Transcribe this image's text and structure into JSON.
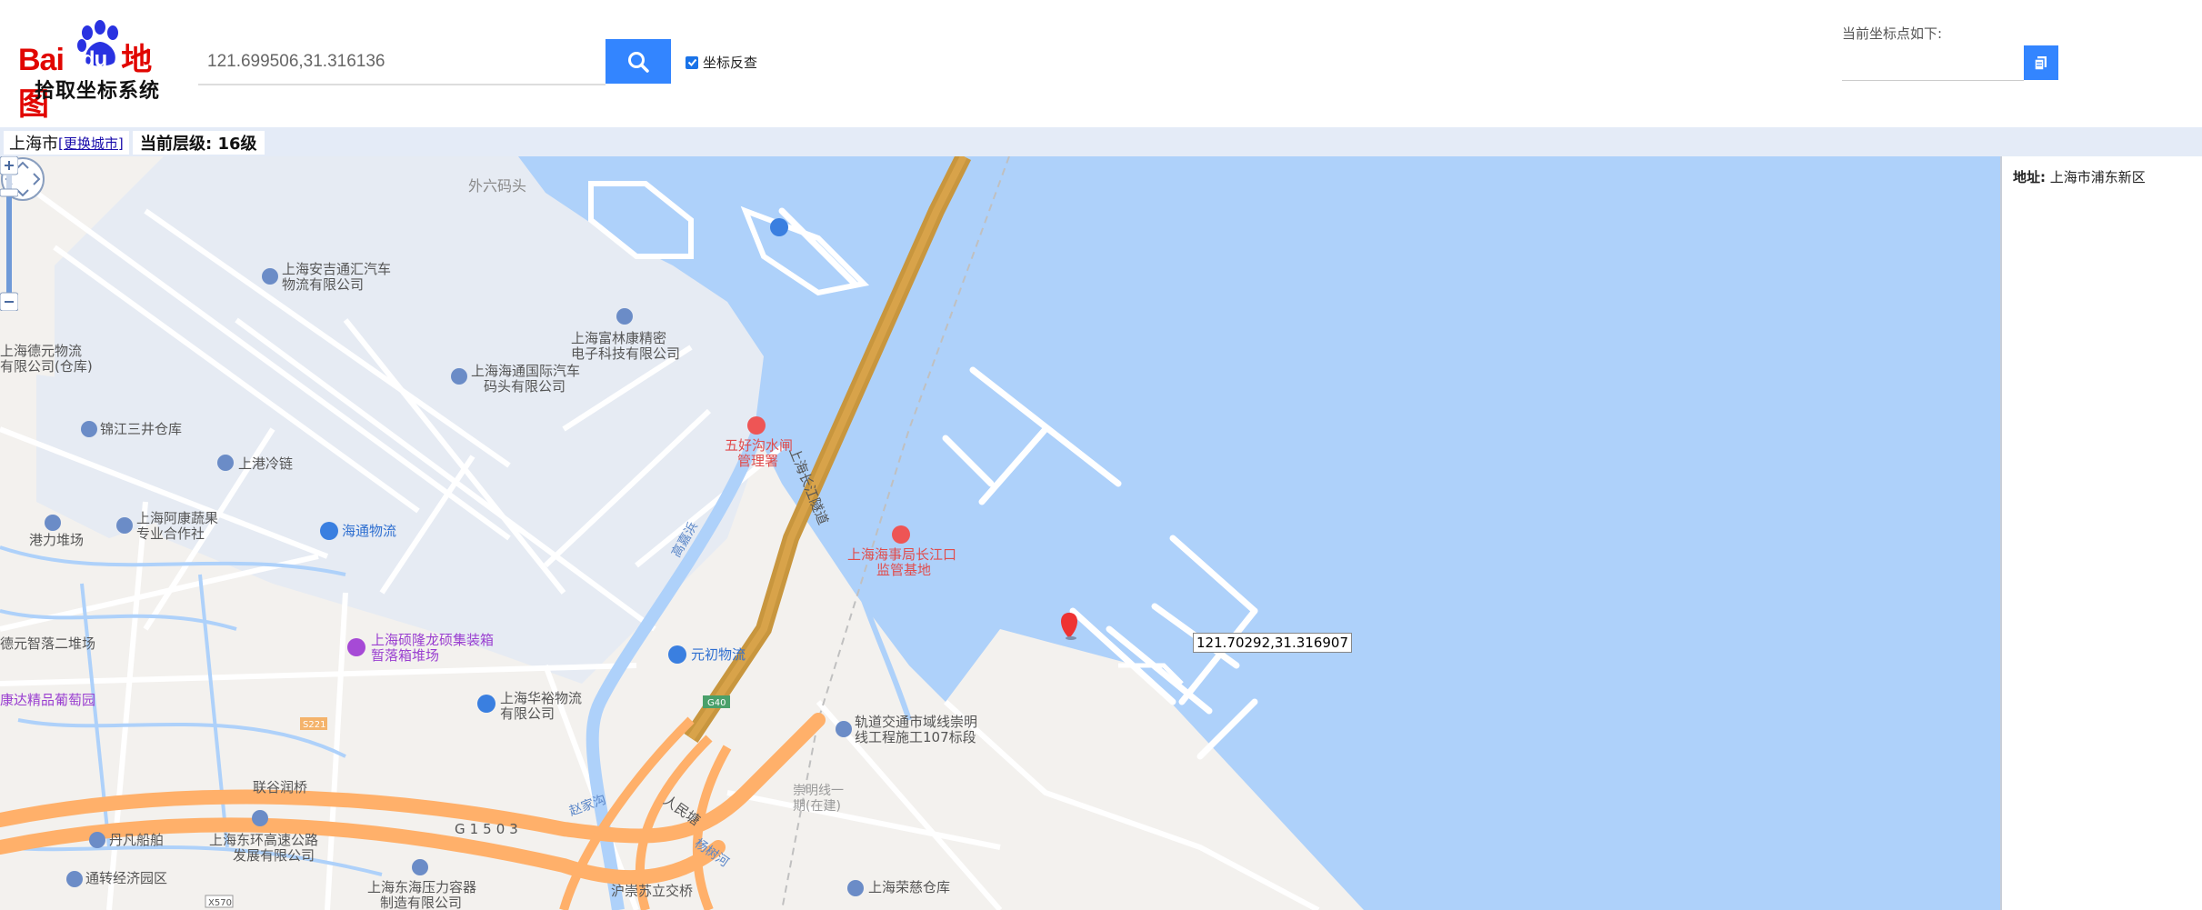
{
  "header": {
    "logo_brand_1": "Bai",
    "logo_brand_2": "du",
    "logo_brand_3": "地图",
    "logo_subtitle": "拾取坐标系统",
    "search_value": "121.699506,31.316136",
    "reverse_label": "坐标反查",
    "reverse_checked": true,
    "coord_label": "当前坐标点如下:",
    "coord_value": ""
  },
  "statusbar": {
    "city": "上海市",
    "change_city": "[更换城市]",
    "zoom_prefix": "当前层级:",
    "zoom_level": "16级"
  },
  "map": {
    "marker_coordinate": "121.70292,31.316907",
    "labels": {
      "waiLiu": "外六码头",
      "anji_1": "上海安吉通汇汽车",
      "anji_2": "物流有限公司",
      "fuji_1": "上海富林康精密",
      "fuji_2": "电子科技有限公司",
      "haitong_1": "上海海通国际汽车",
      "haitong_2": "码头有限公司",
      "yuan_1": "上海德元物流",
      "yuan_2": "有限公司(仓库)",
      "jinjiang": "锦江三井仓库",
      "shanggang": "上港冷链",
      "wuhao_1": "五好沟水闸",
      "wuhao_2": "管理署",
      "tunnel": "上海长江隧道",
      "guyu": "高嘉浜",
      "gangli": "港力堆场",
      "aikang_1": "上海阿康蔬果",
      "aikang_2": "专业合作社",
      "haitongwl": "海通物流",
      "haishi_1": "上海海事局长江口",
      "haishi_2": "监管基地",
      "yuanzhi": "德元智落二堆场",
      "shuolong_1": "上海硕隆龙硕集装箱",
      "shuolong_2": "暂落箱堆场",
      "yuanchu": "元初物流",
      "kangda": "康达精品葡萄园",
      "huayu_1": "上海华裕物流",
      "huayu_2": "有限公司",
      "s221": "S221",
      "g40": "G40",
      "guidao_1": "轨道交通市域线崇明",
      "guidao_2": "线工程施工107标段",
      "lianyi": "联谷润桥",
      "chongming_1": "崇明线一",
      "chongming_2": "期(在建)",
      "danfan": "丹凡船舶",
      "donghuan_1": "上海东环高速公路",
      "donghuan_2": "发展有限公司",
      "g1503": "G1503",
      "zhaojia": "赵家沟",
      "renmin": "人民塘",
      "tongzhuan": "通转经济园区",
      "x570": "X570",
      "yaliqi_1": "上海东海压力容器",
      "yaliqi_2": "制造有限公司",
      "huchong": "沪崇苏立交桥",
      "rongci": "上海荣慈仓库",
      "yangshu": "杨树河"
    }
  },
  "side": {
    "address_key": "地址:",
    "address_value": "上海市浦东新区"
  },
  "colors": {
    "accent": "#3385ff",
    "water": "#aed1fa",
    "land": "#f3f1ee",
    "port": "#e6ebf3",
    "highway": "#ffb06a",
    "tunnel": "#c8963e",
    "status_bar": "#e4ebf7"
  }
}
